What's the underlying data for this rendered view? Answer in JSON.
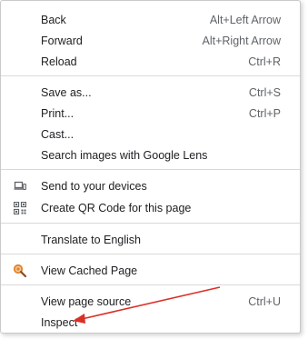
{
  "menu": {
    "back": {
      "label": "Back",
      "shortcut": "Alt+Left Arrow"
    },
    "forward": {
      "label": "Forward",
      "shortcut": "Alt+Right Arrow"
    },
    "reload": {
      "label": "Reload",
      "shortcut": "Ctrl+R"
    },
    "save_as": {
      "label": "Save as...",
      "shortcut": "Ctrl+S"
    },
    "print": {
      "label": "Print...",
      "shortcut": "Ctrl+P"
    },
    "cast": {
      "label": "Cast..."
    },
    "search_lens": {
      "label": "Search images with Google Lens"
    },
    "send_devices": {
      "label": "Send to your devices",
      "icon": "devices-icon"
    },
    "qr_code": {
      "label": "Create QR Code for this page",
      "icon": "qr-code-icon"
    },
    "translate": {
      "label": "Translate to English"
    },
    "cached": {
      "label": "View Cached Page",
      "icon": "cached-page-icon"
    },
    "view_source": {
      "label": "View page source",
      "shortcut": "Ctrl+U"
    },
    "inspect": {
      "label": "Inspect"
    }
  },
  "annotation": {
    "arrow_color": "#d93025"
  }
}
